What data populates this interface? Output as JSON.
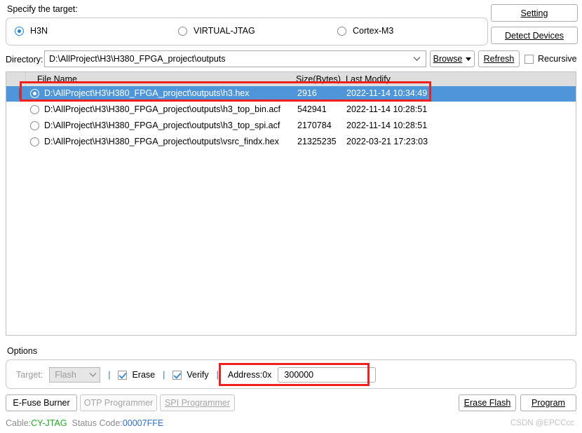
{
  "target_section": {
    "label": "Specify the target:",
    "options": [
      {
        "label": "H3N",
        "selected": true
      },
      {
        "label": "VIRTUAL-JTAG",
        "selected": false
      },
      {
        "label": "Cortex-M3",
        "selected": false
      }
    ],
    "setting_button": "Setting",
    "detect_button": "Detect Devices"
  },
  "directory_row": {
    "label": "Directory:",
    "value": "D:\\AllProject\\H3\\H380_FPGA_project\\outputs",
    "browse_button": "Browse",
    "refresh_button": "Refresh",
    "recursive_label": "Recursive",
    "recursive_checked": false
  },
  "file_list": {
    "columns": [
      "File Name",
      "Size(Bytes)",
      "Last Modify"
    ],
    "rows": [
      {
        "name": "D:\\AllProject\\H3\\H380_FPGA_project\\outputs\\h3.hex",
        "size": "2916",
        "modified": "2022-11-14 10:34:49",
        "selected": true
      },
      {
        "name": "D:\\AllProject\\H3\\H380_FPGA_project\\outputs\\h3_top_bin.acf",
        "size": "542941",
        "modified": "2022-11-14 10:28:51",
        "selected": false
      },
      {
        "name": "D:\\AllProject\\H3\\H380_FPGA_project\\outputs\\h3_top_spi.acf",
        "size": "2170784",
        "modified": "2022-11-14 10:28:51",
        "selected": false
      },
      {
        "name": "D:\\AllProject\\H3\\H380_FPGA_project\\outputs\\vsrc_findx.hex",
        "size": "21325235",
        "modified": "2022-03-21 17:23:03",
        "selected": false
      }
    ]
  },
  "options": {
    "group_label": "Options",
    "target_label": "Target:",
    "target_value": "Flash",
    "target_disabled": true,
    "separator": "|",
    "erase_label": "Erase",
    "erase_checked": true,
    "verify_label": "Verify",
    "verify_checked": true,
    "address_label": "Address:0x",
    "address_value": "300000"
  },
  "bottom_buttons": {
    "efuse": "E-Fuse Burner",
    "otp": "OTP Programmer",
    "spi": "SPI Programmer",
    "erase_flash": "Erase Flash",
    "program": "Program"
  },
  "status_bar": {
    "cable_key": "Cable:",
    "cable_value": "CY-JTAG",
    "code_key": "Status Code:",
    "code_value": "00007FFE"
  },
  "watermark": "CSDN @EPCCcc",
  "colors": {
    "selection_blue": "#4f95d9",
    "header_gray": "#dedede",
    "annotation_red": "#f02020",
    "cable_green": "#1faa1f",
    "status_code_blue": "#2f6fd0",
    "accent_radio_blue": "#1c84d8"
  }
}
